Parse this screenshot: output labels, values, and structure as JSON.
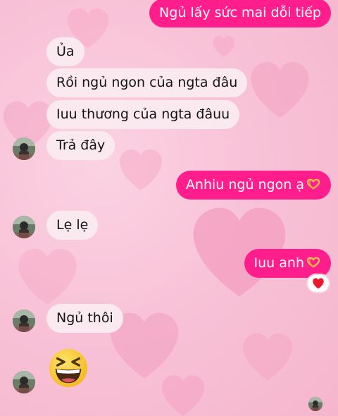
{
  "conversation": {
    "messages": [
      {
        "from": "me",
        "text": "Ngủ lấy sức mai dỗi tiếp"
      },
      {
        "from": "them",
        "text": "Ủa"
      },
      {
        "from": "them",
        "text": "Rồi ngủ ngon của ngta đâu"
      },
      {
        "from": "them",
        "text": "Iuu thương của ngta đâuu"
      },
      {
        "from": "them",
        "text": "Trả đây"
      },
      {
        "from": "me",
        "text": "Anhiu ngủ ngon ạ",
        "emoji": "heart-hands-icon"
      },
      {
        "from": "them",
        "text": "Lẹ lẹ"
      },
      {
        "from": "me",
        "text": "Iuu anh",
        "emoji": "heart-hands-icon",
        "reaction": "red-heart-icon"
      },
      {
        "from": "them",
        "text": "Ngủ thôi"
      },
      {
        "from": "them",
        "emoji": "grinning-squinting-face-icon"
      }
    ]
  },
  "colors": {
    "outgoing_bubble": "#ff1e8c",
    "incoming_bubble": "#fbe9f0",
    "background": "#f8c2d7"
  }
}
